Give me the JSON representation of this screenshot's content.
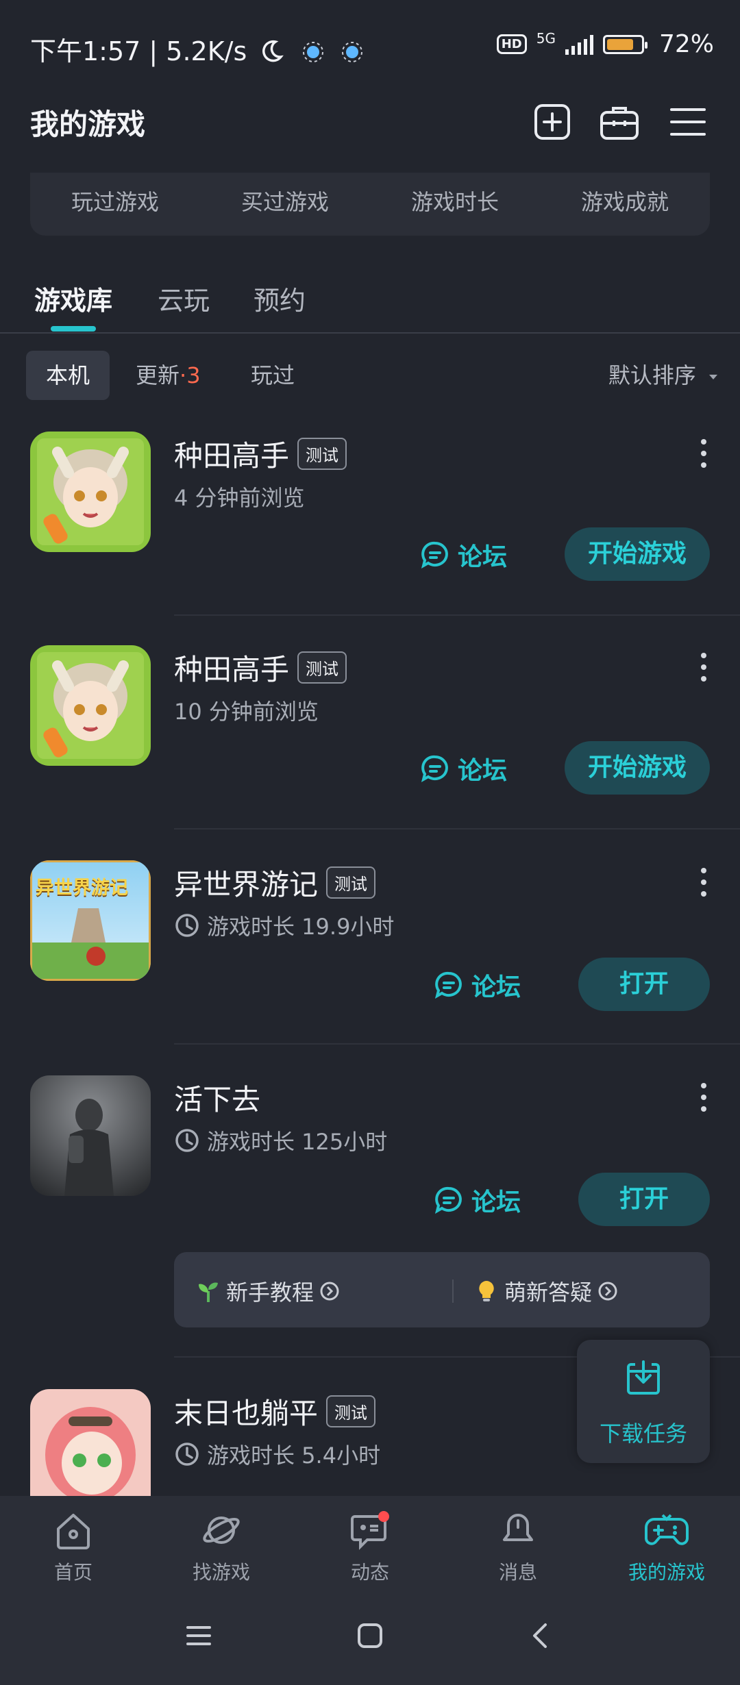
{
  "status_bar": {
    "time_speed": "下午1:57 | 5.2K/s",
    "hd": "HD",
    "network": "5G",
    "battery": "72%"
  },
  "header": {
    "title": "我的游戏",
    "icons": [
      "add-square-icon",
      "toolbox-icon",
      "menu-icon"
    ]
  },
  "stats": [
    "玩过游戏",
    "买过游戏",
    "游戏时长",
    "游戏成就"
  ],
  "main_tabs": [
    "游戏库",
    "云玩",
    "预约"
  ],
  "sub_tabs": {
    "local": "本机",
    "update": "更新",
    "update_sep": "·",
    "update_count": "3",
    "played": "玩过"
  },
  "sort": "默认排序",
  "games": [
    {
      "title": "种田高手",
      "badge": "测试",
      "meta": "4 分钟前浏览",
      "forum": "论坛",
      "action": "开始游戏"
    },
    {
      "title": "种田高手",
      "badge": "测试",
      "meta": "10 分钟前浏览",
      "forum": "论坛",
      "action": "开始游戏"
    },
    {
      "title": "异世界游记",
      "badge": "测试",
      "meta": "游戏时长 19.9小时",
      "forum": "论坛",
      "action": "打开",
      "icon_text": "异世界游记"
    },
    {
      "title": "活下去",
      "badge": "",
      "meta": "游戏时长 125小时",
      "forum": "论坛",
      "action": "打开"
    },
    {
      "title": "末日也躺平",
      "badge": "测试",
      "meta": "游戏时长 5.4小时"
    }
  ],
  "tips": {
    "tutorial": "新手教程",
    "qa": "萌新答疑"
  },
  "download_task": "下载任务",
  "bottom_nav": [
    {
      "label": "首页",
      "icon": "home-icon"
    },
    {
      "label": "找游戏",
      "icon": "planet-icon"
    },
    {
      "label": "动态",
      "icon": "feed-icon"
    },
    {
      "label": "消息",
      "icon": "bell-icon"
    },
    {
      "label": "我的游戏",
      "icon": "gamepad-icon"
    }
  ],
  "colors": {
    "background": "#22252d",
    "accent": "#27c4cd",
    "update_count": "#ff6a4f",
    "button_bg": "#1f4a54"
  }
}
